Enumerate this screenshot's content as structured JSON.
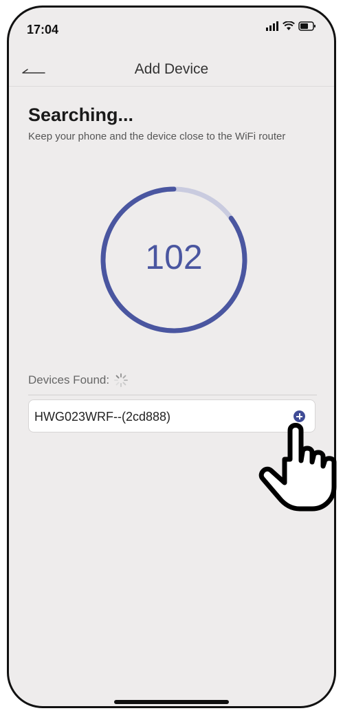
{
  "status_bar": {
    "time": "17:04",
    "icons": [
      "cellular-icon",
      "wifi-icon",
      "battery-icon"
    ]
  },
  "nav": {
    "title": "Add Device",
    "back_icon": "back-arrow-icon"
  },
  "search": {
    "heading": "Searching...",
    "subtitle": "Keep your phone and the device close to the WiFi router",
    "countdown": "102",
    "progress_fraction": 0.85
  },
  "devices": {
    "label": "Devices Found:",
    "items": [
      {
        "name": "HWG023WRF--(2cd888)",
        "action_icon": "plus-circle-icon"
      }
    ]
  },
  "colors": {
    "accent": "#4a56a0",
    "ring_track": "#c9cbdf",
    "background": "#eeecec"
  }
}
